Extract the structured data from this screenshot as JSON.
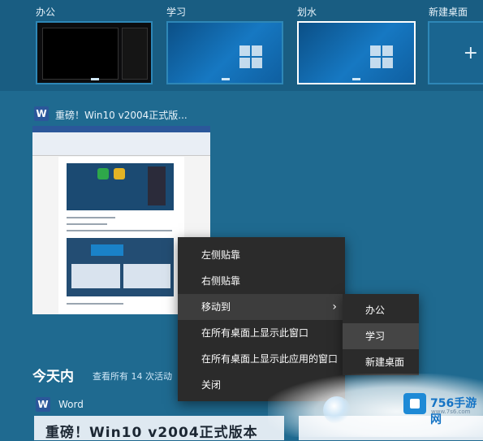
{
  "desktops": [
    {
      "label": "办公",
      "theme": "dark"
    },
    {
      "label": "学习",
      "theme": "blue"
    },
    {
      "label": "划水",
      "theme": "blue",
      "selected": true
    },
    {
      "label": "新建桌面",
      "theme": "new",
      "icon": "plus-icon"
    }
  ],
  "window": {
    "app_icon": "W",
    "title": "重磅！Win10 v2004正式版..."
  },
  "context_menu": {
    "items": [
      {
        "label": "左侧贴靠"
      },
      {
        "label": "右侧贴靠"
      },
      {
        "label": "移动到",
        "has_submenu": true,
        "icon": "chevron-right-icon",
        "chevron": "›"
      },
      {
        "label": "在所有桌面上显示此窗口"
      },
      {
        "label": "在所有桌面上显示此应用的窗口"
      },
      {
        "label": "关闭"
      }
    ],
    "submenu": [
      {
        "label": "办公"
      },
      {
        "label": "学习",
        "highlighted": true
      },
      {
        "label": "新建桌面"
      }
    ]
  },
  "timeline": {
    "heading": "今天内",
    "see_all": "查看所有 14 次活动",
    "card_app_icon": "W",
    "card_app": "Word",
    "card_text": "重磅！Win10 v2004正式版本"
  },
  "watermark": {
    "brand": "756手游网",
    "url": "www.7s6.com"
  },
  "colors": {
    "background": "#1f6a90",
    "strip": "#195d82",
    "menu": "#2b2b2b",
    "accent": "#2e87b7",
    "word_blue": "#2b579a"
  }
}
